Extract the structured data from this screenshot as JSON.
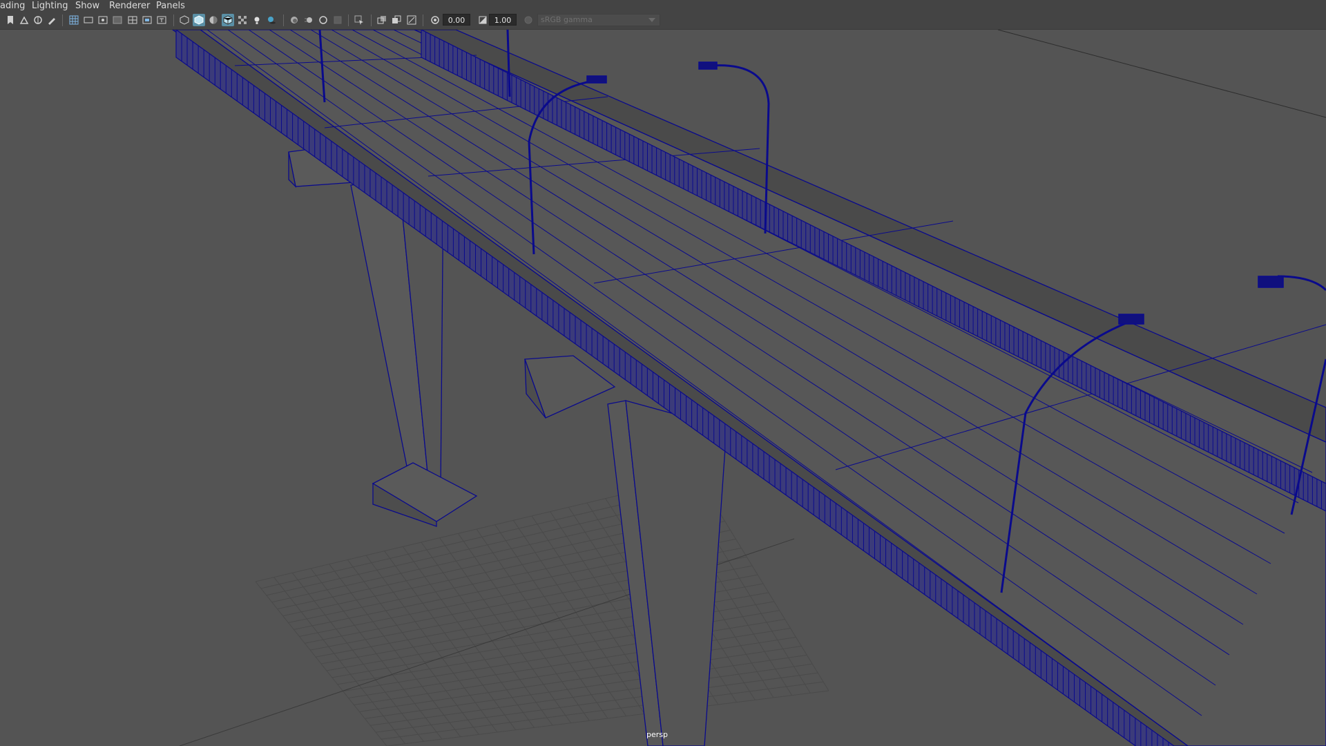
{
  "menubar": {
    "items": [
      {
        "label": "ading"
      },
      {
        "label": "Lighting"
      },
      {
        "label": "Show"
      },
      {
        "label": "Renderer"
      },
      {
        "label": "Panels"
      }
    ]
  },
  "toolbar": {
    "icons": [
      "bookmark-icon",
      "camera-attr-icon",
      "tumble-icon",
      "brush-icon",
      "grid-icon",
      "film-gate-icon",
      "resolution-gate-icon",
      "gate-mask-icon",
      "field-chart-icon",
      "safe-action-icon",
      "safe-title-icon",
      "wireframe-icon",
      "smooth-shade-icon",
      "default-material-icon",
      "wireframe-on-shaded-icon",
      "textured-icon",
      "lights-icon",
      "shadows-icon",
      "ambient-occlusion-icon",
      "motion-blur-icon",
      "anti-aliasing-icon",
      "depth-of-field-icon",
      "isolate-select-icon",
      "xray-icon",
      "xray-active-icon",
      "xray-joints-icon",
      "exposure-icon",
      "gamma-icon"
    ],
    "exposure_value": "0.00",
    "gamma_value": "1.00",
    "colorspace": "sRGB gamma"
  },
  "viewport": {
    "camera_label": "persp"
  },
  "colors": {
    "wire": "#0a0a8c",
    "rail_fill": "#10107e",
    "grid": "#4a4a4a",
    "background": "#545454"
  }
}
